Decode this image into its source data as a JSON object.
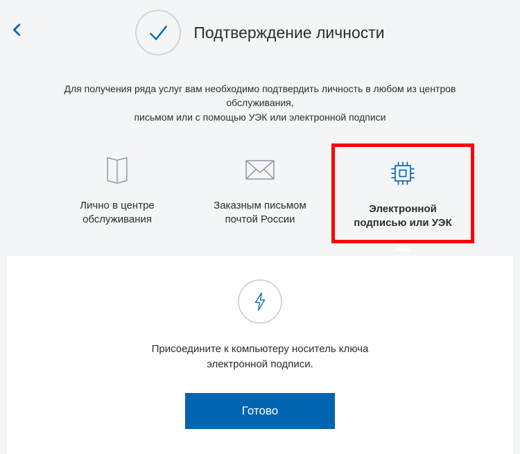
{
  "header": {
    "title": "Подтверждение личности"
  },
  "description": {
    "line1": "Для получения ряда услуг вам необходимо подтвердить личность в любом из центров обслуживания,",
    "line2": "письмом или с помощью УЭК или электронной подписи"
  },
  "options": [
    {
      "label_line1": "Лично в центре",
      "label_line2": "обслуживания",
      "icon": "map-icon",
      "highlighted": false
    },
    {
      "label_line1": "Заказным письмом",
      "label_line2": "почтой России",
      "icon": "envelope-icon",
      "highlighted": false
    },
    {
      "label_line1": "Электронной",
      "label_line2": "подписью или УЭК",
      "icon": "chip-icon",
      "highlighted": true
    }
  ],
  "panel": {
    "instruction_line1": "Присоедините к компьютеру носитель ключа",
    "instruction_line2": "электронной подписи.",
    "button_label": "Готово"
  },
  "colors": {
    "accent": "#0065b1",
    "icon_stroke": "#8f9aa3",
    "highlight_border": "#ff0000"
  }
}
